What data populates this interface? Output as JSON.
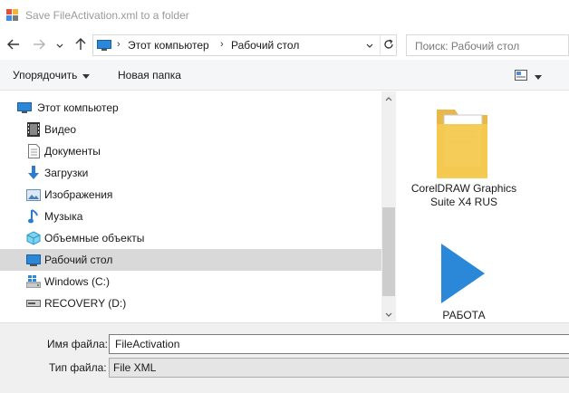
{
  "window": {
    "title": "Save FileActivation.xml to a folder"
  },
  "navigation": {
    "back_icon": "arrow-left-icon",
    "forward_icon": "arrow-right-icon",
    "recent_icon": "chevron-down-icon",
    "up_icon": "arrow-up-icon",
    "breadcrumb": [
      "Этот компьютер",
      "Рабочий стол"
    ],
    "separator": "›",
    "search_placeholder": "Поиск: Рабочий стол"
  },
  "toolbar": {
    "organize_label": "Упорядочить",
    "new_folder_label": "Новая папка"
  },
  "nav_tree": {
    "root": "Этот компьютер",
    "items": [
      {
        "label": "Видео",
        "icon": "video-folder-icon"
      },
      {
        "label": "Документы",
        "icon": "documents-folder-icon"
      },
      {
        "label": "Загрузки",
        "icon": "downloads-folder-icon"
      },
      {
        "label": "Изображения",
        "icon": "pictures-folder-icon"
      },
      {
        "label": "Музыка",
        "icon": "music-folder-icon"
      },
      {
        "label": "Объемные объекты",
        "icon": "3d-objects-folder-icon"
      },
      {
        "label": "Рабочий стол",
        "icon": "desktop-folder-icon",
        "selected": true
      },
      {
        "label": "Windows (C:)",
        "icon": "windows-drive-icon"
      },
      {
        "label": "RECOVERY (D:)",
        "icon": "drive-icon"
      }
    ]
  },
  "files": [
    {
      "label": "CorelDRAW Graphics Suite X4 RUS",
      "icon": "folder-icon"
    },
    {
      "label": "РАБОТА",
      "icon": "shortcut-play-icon"
    }
  ],
  "form": {
    "filename_label": "Имя файла:",
    "filename_value": "FileActivation",
    "filetype_label": "Тип файла:",
    "filetype_value": "File XML"
  },
  "colors": {
    "selection": "#d9d9d9",
    "folder": "#f5c94f",
    "accent_blue": "#2b88d8"
  }
}
